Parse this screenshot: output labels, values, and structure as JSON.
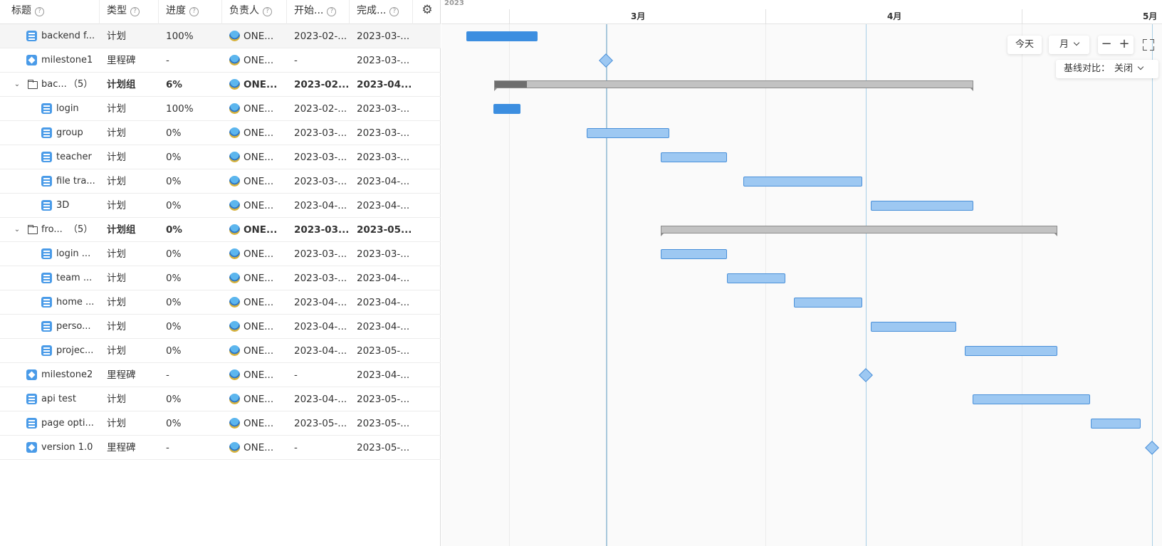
{
  "columns": {
    "title": "标题",
    "type": "类型",
    "progress": "进度",
    "owner": "负责人",
    "start": "开始...",
    "end": "完成..."
  },
  "rows": [
    {
      "kind": "plan",
      "title": "backend f...",
      "type": "计划",
      "progress": "100%",
      "owner": "ONE...",
      "start": "2023-02-...",
      "end": "2023-03-..."
    },
    {
      "kind": "milestone",
      "title": "milestone1",
      "type": "里程碑",
      "progress": "-",
      "owner": "ONE...",
      "start": "-",
      "end": "2023-03-..."
    },
    {
      "kind": "group",
      "title": "bac...",
      "count": "（5）",
      "type": "计划组",
      "progress": "6%",
      "owner": "ONE...",
      "start": "2023-02...",
      "end": "2023-04..."
    },
    {
      "kind": "plan",
      "title": "login",
      "type": "计划",
      "progress": "100%",
      "owner": "ONE...",
      "start": "2023-02-...",
      "end": "2023-03-..."
    },
    {
      "kind": "plan",
      "title": "group",
      "type": "计划",
      "progress": "0%",
      "owner": "ONE...",
      "start": "2023-03-...",
      "end": "2023-03-..."
    },
    {
      "kind": "plan",
      "title": "teacher",
      "type": "计划",
      "progress": "0%",
      "owner": "ONE...",
      "start": "2023-03-...",
      "end": "2023-03-..."
    },
    {
      "kind": "plan",
      "title": "file tra...",
      "type": "计划",
      "progress": "0%",
      "owner": "ONE...",
      "start": "2023-03-...",
      "end": "2023-04-..."
    },
    {
      "kind": "plan",
      "title": "3D",
      "type": "计划",
      "progress": "0%",
      "owner": "ONE...",
      "start": "2023-04-...",
      "end": "2023-04-..."
    },
    {
      "kind": "group",
      "title": "fro...",
      "count": "（5）",
      "type": "计划组",
      "progress": "0%",
      "owner": "ONE...",
      "start": "2023-03...",
      "end": "2023-05..."
    },
    {
      "kind": "plan",
      "title": "login ...",
      "type": "计划",
      "progress": "0%",
      "owner": "ONE...",
      "start": "2023-03-...",
      "end": "2023-03-..."
    },
    {
      "kind": "plan",
      "title": "team ...",
      "type": "计划",
      "progress": "0%",
      "owner": "ONE...",
      "start": "2023-03-...",
      "end": "2023-04-..."
    },
    {
      "kind": "plan",
      "title": "home ...",
      "type": "计划",
      "progress": "0%",
      "owner": "ONE...",
      "start": "2023-04-...",
      "end": "2023-04-..."
    },
    {
      "kind": "plan",
      "title": "perso...",
      "type": "计划",
      "progress": "0%",
      "owner": "ONE...",
      "start": "2023-04-...",
      "end": "2023-04-..."
    },
    {
      "kind": "plan",
      "title": "projec...",
      "type": "计划",
      "progress": "0%",
      "owner": "ONE...",
      "start": "2023-04-...",
      "end": "2023-05-..."
    },
    {
      "kind": "milestone",
      "title": "milestone2",
      "type": "里程碑",
      "progress": "-",
      "owner": "ONE...",
      "start": "-",
      "end": "2023-04-..."
    },
    {
      "kind": "plan",
      "title": "api test",
      "type": "计划",
      "progress": "0%",
      "owner": "ONE...",
      "start": "2023-04-...",
      "end": "2023-05-..."
    },
    {
      "kind": "plan",
      "title": "page opti...",
      "type": "计划",
      "progress": "0%",
      "owner": "ONE...",
      "start": "2023-05-...",
      "end": "2023-05-..."
    },
    {
      "kind": "milestone",
      "title": "version 1.0",
      "type": "里程碑",
      "progress": "-",
      "owner": "ONE...",
      "start": "-",
      "end": "2023-05-..."
    }
  ],
  "timeline": {
    "year": "2023",
    "months": [
      "3月",
      "4月",
      "5月"
    ]
  },
  "toolbar": {
    "today": "今天",
    "scale": "月",
    "baseline_label": "基线对比：",
    "baseline_value": "关闭"
  },
  "colors": {
    "done": "#3c8ee0",
    "todo": "#9dc8f2",
    "group": "#c2c2c2",
    "group_done": "#6e6e6e",
    "icon": "#4a9be8"
  }
}
